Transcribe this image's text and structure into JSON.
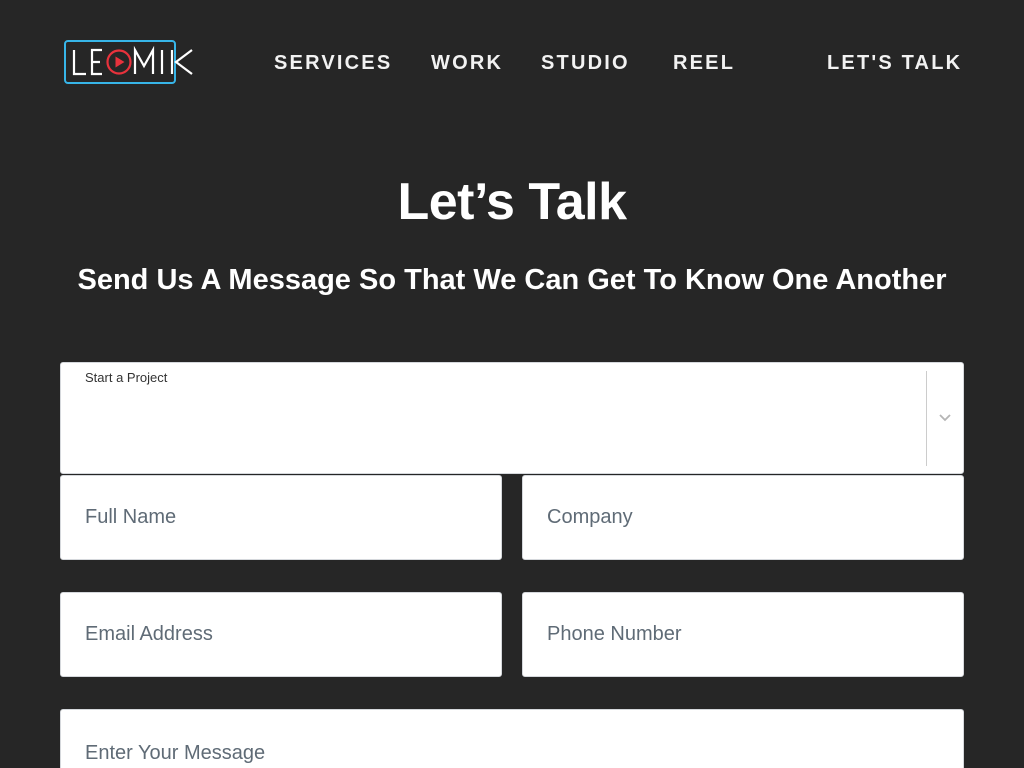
{
  "header": {
    "logo": {
      "text": "LEOMIK",
      "icon": "play-circle-icon",
      "frame_color": "#37b5e8",
      "accent_color": "#e8323c"
    },
    "nav": {
      "services": "SERVICES",
      "work": "WORK",
      "studio": "STUDIO",
      "reel": "REEL",
      "lets_talk": "LET'S TALK"
    }
  },
  "main": {
    "title": "Let’s Talk",
    "subtitle": "Send Us A Message So That We Can Get To Know One Another"
  },
  "form": {
    "project_select": {
      "label": "Start a Project",
      "value": "",
      "icon": "chevron-down-icon"
    },
    "full_name": {
      "placeholder": "Full Name",
      "value": ""
    },
    "company": {
      "placeholder": "Company",
      "value": ""
    },
    "email": {
      "placeholder": "Email Address",
      "value": ""
    },
    "phone": {
      "placeholder": "Phone Number",
      "value": ""
    },
    "message": {
      "placeholder": "Enter Your Message",
      "value": ""
    }
  },
  "colors": {
    "background": "#262626",
    "text": "#ffffff",
    "field_bg": "#ffffff",
    "placeholder": "#5f6b76"
  }
}
